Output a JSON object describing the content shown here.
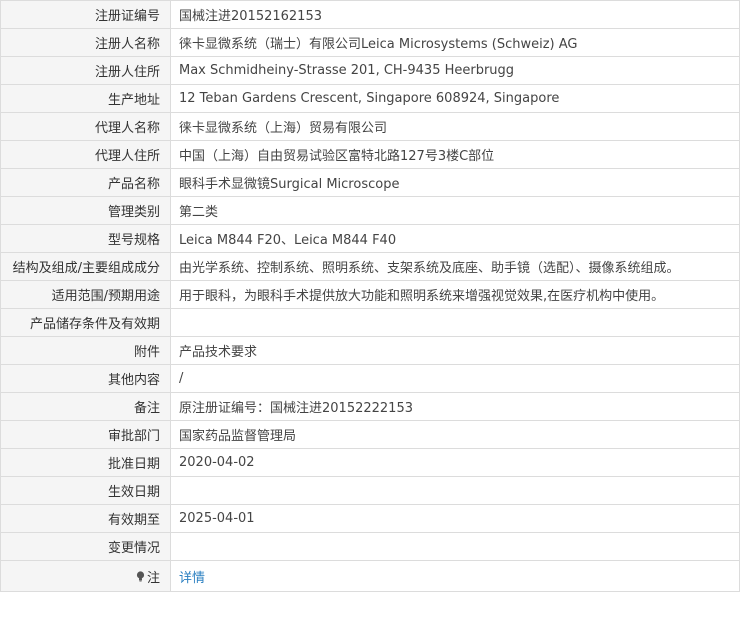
{
  "rows": [
    {
      "label": "注册证编号",
      "value": "国械注进20152162153"
    },
    {
      "label": "注册人名称",
      "value": "徕卡显微系统（瑞士）有限公司Leica Microsystems (Schweiz) AG"
    },
    {
      "label": "注册人住所",
      "value": "Max Schmidheiny-Strasse 201, CH-9435 Heerbrugg"
    },
    {
      "label": "生产地址",
      "value": "12 Teban Gardens Crescent, Singapore 608924, Singapore"
    },
    {
      "label": "代理人名称",
      "value": "徕卡显微系统（上海）贸易有限公司"
    },
    {
      "label": "代理人住所",
      "value": "中国（上海）自由贸易试验区富特北路127号3楼C部位"
    },
    {
      "label": "产品名称",
      "value": "眼科手术显微镜Surgical Microscope"
    },
    {
      "label": "管理类别",
      "value": "第二类"
    },
    {
      "label": "型号规格",
      "value": "Leica M844 F20、Leica M844 F40"
    },
    {
      "label": "结构及组成/主要组成成分",
      "value": "由光学系统、控制系统、照明系统、支架系统及底座、助手镜（选配）、摄像系统组成。"
    },
    {
      "label": "适用范围/预期用途",
      "value": "用于眼科，为眼科手术提供放大功能和照明系统来增强视觉效果,在医疗机构中使用。"
    },
    {
      "label": "产品储存条件及有效期",
      "value": ""
    },
    {
      "label": "附件",
      "value": "产品技术要求"
    },
    {
      "label": "其他内容",
      "value": "/"
    },
    {
      "label": "备注",
      "value": "原注册证编号：国械注进20152222153"
    },
    {
      "label": "审批部门",
      "value": "国家药品监督管理局"
    },
    {
      "label": "批准日期",
      "value": "2020-04-02"
    },
    {
      "label": "生效日期",
      "value": ""
    },
    {
      "label": "有效期至",
      "value": "2025-04-01"
    },
    {
      "label": "变更情况",
      "value": ""
    }
  ],
  "note_row": {
    "label": "注",
    "icon": "lightbulb-icon",
    "link_text": "详情",
    "link_color": "#2a7fc1"
  }
}
